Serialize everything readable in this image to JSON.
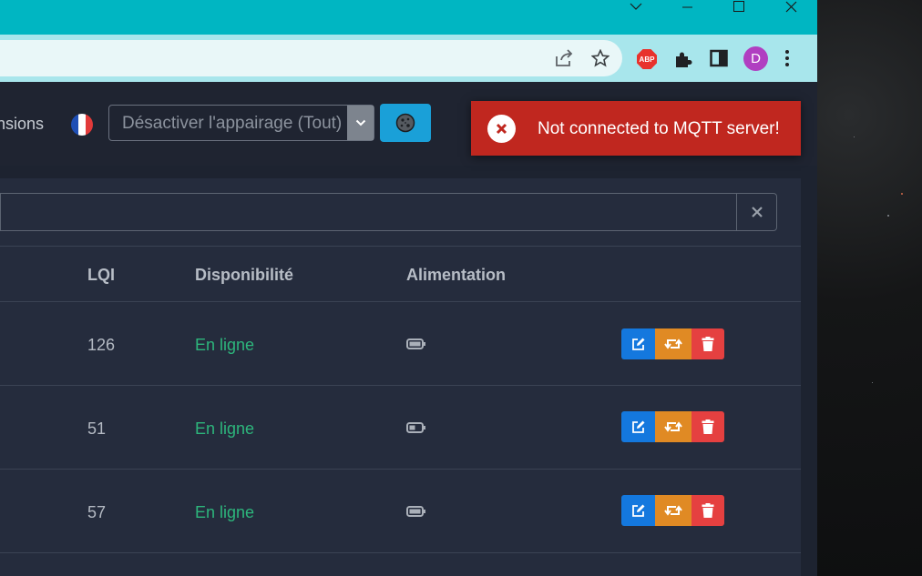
{
  "navbar": {
    "partial_text": "nsions",
    "language_flag": "flag-france-icon",
    "pairing_select": {
      "selected": "Désactiver l'appairage (Tout)"
    },
    "theme_button_icon": "cookie-icon"
  },
  "toast": {
    "icon": "error-circle-icon",
    "message": "Not connected to MQTT server!"
  },
  "filter": {
    "clear_icon": "close-icon"
  },
  "table": {
    "headers": {
      "lqi": "LQI",
      "availability": "Disponibilité",
      "power": "Alimentation"
    },
    "rows": [
      {
        "lqi": "126",
        "availability": "En ligne",
        "power_icon": "battery-full-icon",
        "battery_level": 0.9
      },
      {
        "lqi": "51",
        "availability": "En ligne",
        "power_icon": "battery-half-icon",
        "battery_level": 0.45
      },
      {
        "lqi": "57",
        "availability": "En ligne",
        "power_icon": "battery-full-icon",
        "battery_level": 0.9
      }
    ]
  },
  "colors": {
    "titlebar": "#00b6c2",
    "toast": "#c0271f",
    "online": "#2db67c",
    "edit": "#1478de",
    "swap": "#e08a24",
    "delete": "#e54040"
  }
}
